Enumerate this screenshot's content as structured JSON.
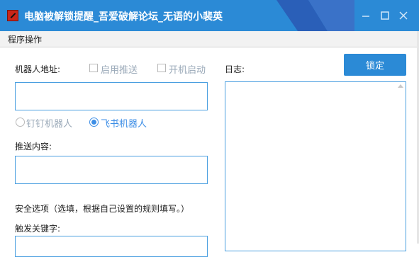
{
  "window": {
    "title": "电脑被解锁提醒_吾爱破解论坛_无语的小裴英"
  },
  "menu": {
    "items": [
      "程序操作"
    ]
  },
  "form": {
    "robot_address_label": "机器人地址:",
    "enable_push_label": "启用推送",
    "autostart_label": "开机启动",
    "enable_push_checked": false,
    "autostart_checked": false,
    "robot_address_value": "",
    "robot_options": [
      {
        "label": "钉钉机器人",
        "selected": false
      },
      {
        "label": "飞书机器人",
        "selected": true
      }
    ],
    "push_content_label": "推送内容:",
    "push_content_value": "",
    "security_label": "安全选项（选填，根据自己设置的规则填写。）",
    "trigger_keyword_label": "触发关键字:"
  },
  "log": {
    "label": "日志:",
    "value": ""
  },
  "buttons": {
    "lock_label": "锁定"
  },
  "colors": {
    "accent": "#2b8ad6",
    "border": "#4a9fe0",
    "radio": "#3d8ee6"
  }
}
